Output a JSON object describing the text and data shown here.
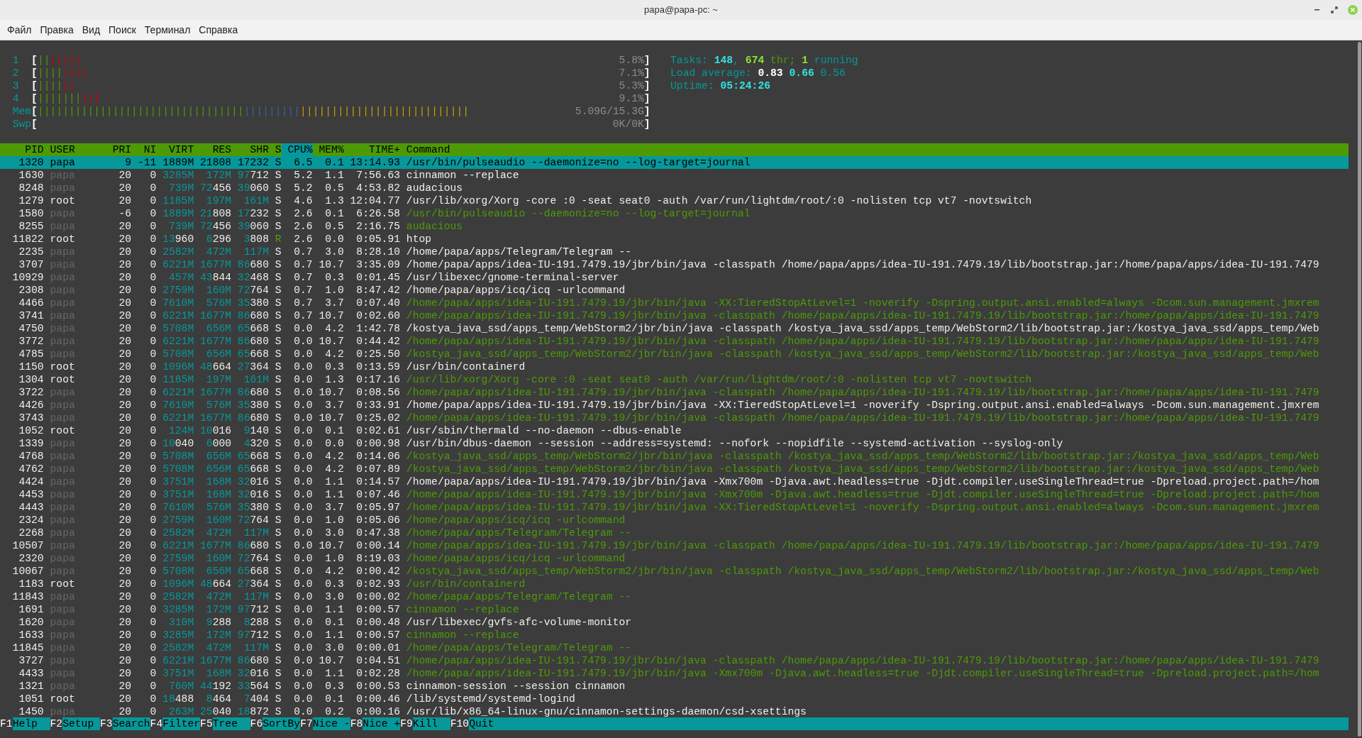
{
  "window": {
    "title": "papa@papa-pc: ~"
  },
  "menu": [
    "Файл",
    "Правка",
    "Вид",
    "Поиск",
    "Терминал",
    "Справка"
  ],
  "meters": [
    {
      "label": "1",
      "open": "[",
      "segments": [
        {
          "text": "||",
          "color": "#4e9a06"
        },
        {
          "text": "|||||",
          "color": "#cc0000"
        }
      ],
      "reading": "5.8%",
      "close": "]"
    },
    {
      "label": "2",
      "open": "[",
      "segments": [
        {
          "text": "||||",
          "color": "#4e9a06"
        },
        {
          "text": "||||",
          "color": "#cc0000"
        }
      ],
      "reading": "7.1%",
      "close": "]"
    },
    {
      "label": "3",
      "open": "[",
      "segments": [
        {
          "text": "||||",
          "color": "#4e9a06"
        },
        {
          "text": "||",
          "color": "#cc0000"
        }
      ],
      "reading": "5.3%",
      "close": "]"
    },
    {
      "label": "4",
      "open": "[",
      "segments": [
        {
          "text": "|||||||",
          "color": "#4e9a06"
        },
        {
          "text": "|||",
          "color": "#cc0000"
        }
      ],
      "reading": "9.1%",
      "close": "]"
    },
    {
      "label": "Mem",
      "open": "[",
      "segments": [
        {
          "text": "|||||||||||||||||||||||||||||||||",
          "color": "#4e9a06"
        },
        {
          "text": "|||||||||",
          "color": "#3465a4"
        },
        {
          "text": "|||||||||||||||||||||||||||",
          "color": "#c4a000"
        }
      ],
      "reading": "5.09G/15.3G",
      "close": "]"
    },
    {
      "label": "Swp",
      "open": "[",
      "reading": "0K/0K",
      "close": "]"
    }
  ],
  "tasks": {
    "label": "Tasks:",
    "total": "148",
    "sep": ",",
    "threads": "674",
    "threads_label": "thr;",
    "running": "1",
    "running_label": "running"
  },
  "load": {
    "label": "Load average:",
    "values": [
      "0.83",
      "0.66",
      "0.56"
    ]
  },
  "uptime": {
    "label": "Uptime:",
    "value": "05:24:26"
  },
  "columns": [
    {
      "label": "PID",
      "sorted": false
    },
    {
      "label": "USER",
      "sorted": false
    },
    {
      "label": "PRI",
      "sorted": false
    },
    {
      "label": "NI",
      "sorted": false
    },
    {
      "label": "VIRT",
      "sorted": false
    },
    {
      "label": "RES",
      "sorted": false
    },
    {
      "label": "SHR",
      "sorted": false
    },
    {
      "label": "S",
      "sorted": false
    },
    {
      "label": "CPU%",
      "sorted": true
    },
    {
      "label": "MEM%",
      "sorted": false
    },
    {
      "label": "TIME+",
      "sorted": false
    },
    {
      "label": "Command",
      "sorted": false
    }
  ],
  "rows": [
    {
      "pid": "1320",
      "user": "papa",
      "user_dim": false,
      "pri": "9",
      "ni": "-11",
      "virt": "1889M",
      "res": "21808",
      "shr": "17232",
      "s": "S",
      "running": false,
      "cpu": "6.5",
      "mem": "0.1",
      "time": "13:14.93",
      "command": "/usr/bin/pulseaudio --daemonize=no --log-target=journal",
      "thread": false,
      "selected": true
    },
    {
      "pid": "1630",
      "user": "papa",
      "user_dim": true,
      "pri": "20",
      "ni": "0",
      "virt": "3285M",
      "res": "172M",
      "shr": "97712",
      "s": "S",
      "running": false,
      "cpu": "5.2",
      "mem": "1.1",
      "time": "7:56.63",
      "command": "cinnamon --replace",
      "thread": false,
      "selected": false
    },
    {
      "pid": "8248",
      "user": "papa",
      "user_dim": true,
      "pri": "20",
      "ni": "0",
      "virt": "739M",
      "res": "72456",
      "shr": "39060",
      "s": "S",
      "running": false,
      "cpu": "5.2",
      "mem": "0.5",
      "time": "4:53.82",
      "command": "audacious",
      "thread": false,
      "selected": false
    },
    {
      "pid": "1279",
      "user": "root",
      "user_dim": false,
      "pri": "20",
      "ni": "0",
      "virt": "1185M",
      "res": "197M",
      "shr": "161M",
      "s": "S",
      "running": false,
      "cpu": "4.6",
      "mem": "1.3",
      "time": "12:04.77",
      "command": "/usr/lib/xorg/Xorg -core :0 -seat seat0 -auth /var/run/lightdm/root/:0 -nolisten tcp vt7 -novtswitch",
      "thread": false,
      "selected": false
    },
    {
      "pid": "1580",
      "user": "papa",
      "user_dim": true,
      "pri": "-6",
      "ni": "0",
      "virt": "1889M",
      "res": "21808",
      "shr": "17232",
      "s": "S",
      "running": false,
      "cpu": "2.6",
      "mem": "0.1",
      "time": "6:26.58",
      "command": "/usr/bin/pulseaudio --daemonize=no --log-target=journal",
      "thread": true,
      "selected": false
    },
    {
      "pid": "8255",
      "user": "papa",
      "user_dim": true,
      "pri": "20",
      "ni": "0",
      "virt": "739M",
      "res": "72456",
      "shr": "39060",
      "s": "S",
      "running": false,
      "cpu": "2.6",
      "mem": "0.5",
      "time": "2:16.75",
      "command": "audacious",
      "thread": true,
      "selected": false
    },
    {
      "pid": "11822",
      "user": "root",
      "user_dim": false,
      "pri": "20",
      "ni": "0",
      "virt": "13960",
      "res": "6296",
      "shr": "3808",
      "s": "R",
      "running": true,
      "cpu": "2.6",
      "mem": "0.0",
      "time": "0:05.91",
      "command": "htop",
      "thread": false,
      "selected": false
    },
    {
      "pid": "2235",
      "user": "papa",
      "user_dim": true,
      "pri": "20",
      "ni": "0",
      "virt": "2582M",
      "res": "472M",
      "shr": "117M",
      "s": "S",
      "running": false,
      "cpu": "0.7",
      "mem": "3.0",
      "time": "8:28.10",
      "command": "/home/papa/apps/Telegram/Telegram --",
      "thread": false,
      "selected": false
    },
    {
      "pid": "3707",
      "user": "papa",
      "user_dim": true,
      "pri": "20",
      "ni": "0",
      "virt": "6221M",
      "res": "1677M",
      "shr": "86680",
      "s": "S",
      "running": false,
      "cpu": "0.7",
      "mem": "10.7",
      "time": "3:35.09",
      "command": "/home/papa/apps/idea-IU-191.7479.19/jbr/bin/java -classpath /home/papa/apps/idea-IU-191.7479.19/lib/bootstrap.jar:/home/papa/apps/idea-IU-191.7479",
      "thread": false,
      "selected": false
    },
    {
      "pid": "10929",
      "user": "papa",
      "user_dim": true,
      "pri": "20",
      "ni": "0",
      "virt": "457M",
      "res": "43844",
      "shr": "32468",
      "s": "S",
      "running": false,
      "cpu": "0.7",
      "mem": "0.3",
      "time": "0:01.45",
      "command": "/usr/libexec/gnome-terminal-server",
      "thread": false,
      "selected": false
    },
    {
      "pid": "2308",
      "user": "papa",
      "user_dim": true,
      "pri": "20",
      "ni": "0",
      "virt": "2759M",
      "res": "160M",
      "shr": "72764",
      "s": "S",
      "running": false,
      "cpu": "0.7",
      "mem": "1.0",
      "time": "8:47.42",
      "command": "/home/papa/apps/icq/icq -urlcommand",
      "thread": false,
      "selected": false
    },
    {
      "pid": "4466",
      "user": "papa",
      "user_dim": true,
      "pri": "20",
      "ni": "0",
      "virt": "7610M",
      "res": "576M",
      "shr": "35380",
      "s": "S",
      "running": false,
      "cpu": "0.7",
      "mem": "3.7",
      "time": "0:07.40",
      "command": "/home/papa/apps/idea-IU-191.7479.19/jbr/bin/java -XX:TieredStopAtLevel=1 -noverify -Dspring.output.ansi.enabled=always -Dcom.sun.management.jmxrem",
      "thread": true,
      "selected": false
    },
    {
      "pid": "3741",
      "user": "papa",
      "user_dim": true,
      "pri": "20",
      "ni": "0",
      "virt": "6221M",
      "res": "1677M",
      "shr": "86680",
      "s": "S",
      "running": false,
      "cpu": "0.7",
      "mem": "10.7",
      "time": "0:02.60",
      "command": "/home/papa/apps/idea-IU-191.7479.19/jbr/bin/java -classpath /home/papa/apps/idea-IU-191.7479.19/lib/bootstrap.jar:/home/papa/apps/idea-IU-191.7479",
      "thread": true,
      "selected": false
    },
    {
      "pid": "4750",
      "user": "papa",
      "user_dim": true,
      "pri": "20",
      "ni": "0",
      "virt": "5708M",
      "res": "656M",
      "shr": "65668",
      "s": "S",
      "running": false,
      "cpu": "0.0",
      "mem": "4.2",
      "time": "1:42.78",
      "command": "/kostya_java_ssd/apps_temp/WebStorm2/jbr/bin/java -classpath /kostya_java_ssd/apps_temp/WebStorm2/lib/bootstrap.jar:/kostya_java_ssd/apps_temp/Web",
      "thread": false,
      "selected": false
    },
    {
      "pid": "3772",
      "user": "papa",
      "user_dim": true,
      "pri": "20",
      "ni": "0",
      "virt": "6221M",
      "res": "1677M",
      "shr": "86680",
      "s": "S",
      "running": false,
      "cpu": "0.0",
      "mem": "10.7",
      "time": "0:44.42",
      "command": "/home/papa/apps/idea-IU-191.7479.19/jbr/bin/java -classpath /home/papa/apps/idea-IU-191.7479.19/lib/bootstrap.jar:/home/papa/apps/idea-IU-191.7479",
      "thread": true,
      "selected": false
    },
    {
      "pid": "4785",
      "user": "papa",
      "user_dim": true,
      "pri": "20",
      "ni": "0",
      "virt": "5708M",
      "res": "656M",
      "shr": "65668",
      "s": "S",
      "running": false,
      "cpu": "0.0",
      "mem": "4.2",
      "time": "0:25.50",
      "command": "/kostya_java_ssd/apps_temp/WebStorm2/jbr/bin/java -classpath /kostya_java_ssd/apps_temp/WebStorm2/lib/bootstrap.jar:/kostya_java_ssd/apps_temp/Web",
      "thread": true,
      "selected": false
    },
    {
      "pid": "1150",
      "user": "root",
      "user_dim": false,
      "pri": "20",
      "ni": "0",
      "virt": "1096M",
      "res": "48664",
      "shr": "27364",
      "s": "S",
      "running": false,
      "cpu": "0.0",
      "mem": "0.3",
      "time": "0:13.59",
      "command": "/usr/bin/containerd",
      "thread": false,
      "selected": false
    },
    {
      "pid": "1304",
      "user": "root",
      "user_dim": false,
      "pri": "20",
      "ni": "0",
      "virt": "1185M",
      "res": "197M",
      "shr": "161M",
      "s": "S",
      "running": false,
      "cpu": "0.0",
      "mem": "1.3",
      "time": "0:17.16",
      "command": "/usr/lib/xorg/Xorg -core :0 -seat seat0 -auth /var/run/lightdm/root/:0 -nolisten tcp vt7 -novtswitch",
      "thread": true,
      "selected": false
    },
    {
      "pid": "3722",
      "user": "papa",
      "user_dim": true,
      "pri": "20",
      "ni": "0",
      "virt": "6221M",
      "res": "1677M",
      "shr": "86680",
      "s": "S",
      "running": false,
      "cpu": "0.0",
      "mem": "10.7",
      "time": "0:08.56",
      "command": "/home/papa/apps/idea-IU-191.7479.19/jbr/bin/java -classpath /home/papa/apps/idea-IU-191.7479.19/lib/bootstrap.jar:/home/papa/apps/idea-IU-191.7479",
      "thread": true,
      "selected": false
    },
    {
      "pid": "4426",
      "user": "papa",
      "user_dim": true,
      "pri": "20",
      "ni": "0",
      "virt": "7610M",
      "res": "576M",
      "shr": "35380",
      "s": "S",
      "running": false,
      "cpu": "0.0",
      "mem": "3.7",
      "time": "0:33.91",
      "command": "/home/papa/apps/idea-IU-191.7479.19/jbr/bin/java -XX:TieredStopAtLevel=1 -noverify -Dspring.output.ansi.enabled=always -Dcom.sun.management.jmxrem",
      "thread": false,
      "selected": false
    },
    {
      "pid": "3743",
      "user": "papa",
      "user_dim": true,
      "pri": "20",
      "ni": "0",
      "virt": "6221M",
      "res": "1677M",
      "shr": "86680",
      "s": "S",
      "running": false,
      "cpu": "0.0",
      "mem": "10.7",
      "time": "0:25.02",
      "command": "/home/papa/apps/idea-IU-191.7479.19/jbr/bin/java -classpath /home/papa/apps/idea-IU-191.7479.19/lib/bootstrap.jar:/home/papa/apps/idea-IU-191.7479",
      "thread": true,
      "selected": false
    },
    {
      "pid": "1052",
      "user": "root",
      "user_dim": false,
      "pri": "20",
      "ni": "0",
      "virt": "124M",
      "res": "10016",
      "shr": "9140",
      "s": "S",
      "running": false,
      "cpu": "0.0",
      "mem": "0.1",
      "time": "0:02.61",
      "command": "/usr/sbin/thermald --no-daemon --dbus-enable",
      "thread": false,
      "selected": false
    },
    {
      "pid": "1339",
      "user": "papa",
      "user_dim": true,
      "pri": "20",
      "ni": "0",
      "virt": "10040",
      "res": "6000",
      "shr": "4320",
      "s": "S",
      "running": false,
      "cpu": "0.0",
      "mem": "0.0",
      "time": "0:00.98",
      "command": "/usr/bin/dbus-daemon --session --address=systemd: --nofork --nopidfile --systemd-activation --syslog-only",
      "thread": false,
      "selected": false
    },
    {
      "pid": "4768",
      "user": "papa",
      "user_dim": true,
      "pri": "20",
      "ni": "0",
      "virt": "5708M",
      "res": "656M",
      "shr": "65668",
      "s": "S",
      "running": false,
      "cpu": "0.0",
      "mem": "4.2",
      "time": "0:14.06",
      "command": "/kostya_java_ssd/apps_temp/WebStorm2/jbr/bin/java -classpath /kostya_java_ssd/apps_temp/WebStorm2/lib/bootstrap.jar:/kostya_java_ssd/apps_temp/Web",
      "thread": true,
      "selected": false
    },
    {
      "pid": "4762",
      "user": "papa",
      "user_dim": true,
      "pri": "20",
      "ni": "0",
      "virt": "5708M",
      "res": "656M",
      "shr": "65668",
      "s": "S",
      "running": false,
      "cpu": "0.0",
      "mem": "4.2",
      "time": "0:07.89",
      "command": "/kostya_java_ssd/apps_temp/WebStorm2/jbr/bin/java -classpath /kostya_java_ssd/apps_temp/WebStorm2/lib/bootstrap.jar:/kostya_java_ssd/apps_temp/Web",
      "thread": true,
      "selected": false
    },
    {
      "pid": "4424",
      "user": "papa",
      "user_dim": true,
      "pri": "20",
      "ni": "0",
      "virt": "3751M",
      "res": "168M",
      "shr": "32016",
      "s": "S",
      "running": false,
      "cpu": "0.0",
      "mem": "1.1",
      "time": "0:14.57",
      "command": "/home/papa/apps/idea-IU-191.7479.19/jbr/bin/java -Xmx700m -Djava.awt.headless=true -Djdt.compiler.useSingleThread=true -Dpreload.project.path=/hom",
      "thread": false,
      "selected": false
    },
    {
      "pid": "4453",
      "user": "papa",
      "user_dim": true,
      "pri": "20",
      "ni": "0",
      "virt": "3751M",
      "res": "168M",
      "shr": "32016",
      "s": "S",
      "running": false,
      "cpu": "0.0",
      "mem": "1.1",
      "time": "0:07.46",
      "command": "/home/papa/apps/idea-IU-191.7479.19/jbr/bin/java -Xmx700m -Djava.awt.headless=true -Djdt.compiler.useSingleThread=true -Dpreload.project.path=/hom",
      "thread": true,
      "selected": false
    },
    {
      "pid": "4443",
      "user": "papa",
      "user_dim": true,
      "pri": "20",
      "ni": "0",
      "virt": "7610M",
      "res": "576M",
      "shr": "35380",
      "s": "S",
      "running": false,
      "cpu": "0.0",
      "mem": "3.7",
      "time": "0:05.97",
      "command": "/home/papa/apps/idea-IU-191.7479.19/jbr/bin/java -XX:TieredStopAtLevel=1 -noverify -Dspring.output.ansi.enabled=always -Dcom.sun.management.jmxrem",
      "thread": true,
      "selected": false
    },
    {
      "pid": "2324",
      "user": "papa",
      "user_dim": true,
      "pri": "20",
      "ni": "0",
      "virt": "2759M",
      "res": "160M",
      "shr": "72764",
      "s": "S",
      "running": false,
      "cpu": "0.0",
      "mem": "1.0",
      "time": "0:05.06",
      "command": "/home/papa/apps/icq/icq -urlcommand",
      "thread": true,
      "selected": false
    },
    {
      "pid": "2268",
      "user": "papa",
      "user_dim": true,
      "pri": "20",
      "ni": "0",
      "virt": "2582M",
      "res": "472M",
      "shr": "117M",
      "s": "S",
      "running": false,
      "cpu": "0.0",
      "mem": "3.0",
      "time": "0:47.38",
      "command": "/home/papa/apps/Telegram/Telegram --",
      "thread": true,
      "selected": false
    },
    {
      "pid": "10507",
      "user": "papa",
      "user_dim": true,
      "pri": "20",
      "ni": "0",
      "virt": "6221M",
      "res": "1677M",
      "shr": "86680",
      "s": "S",
      "running": false,
      "cpu": "0.0",
      "mem": "10.7",
      "time": "0:00.14",
      "command": "/home/papa/apps/idea-IU-191.7479.19/jbr/bin/java -classpath /home/papa/apps/idea-IU-191.7479.19/lib/bootstrap.jar:/home/papa/apps/idea-IU-191.7479",
      "thread": true,
      "selected": false
    },
    {
      "pid": "2320",
      "user": "papa",
      "user_dim": true,
      "pri": "20",
      "ni": "0",
      "virt": "2759M",
      "res": "160M",
      "shr": "72764",
      "s": "S",
      "running": false,
      "cpu": "0.0",
      "mem": "1.0",
      "time": "8:19.03",
      "command": "/home/papa/apps/icq/icq -urlcommand",
      "thread": true,
      "selected": false
    },
    {
      "pid": "10067",
      "user": "papa",
      "user_dim": true,
      "pri": "20",
      "ni": "0",
      "virt": "5708M",
      "res": "656M",
      "shr": "65668",
      "s": "S",
      "running": false,
      "cpu": "0.0",
      "mem": "4.2",
      "time": "0:00.42",
      "command": "/kostya_java_ssd/apps_temp/WebStorm2/jbr/bin/java -classpath /kostya_java_ssd/apps_temp/WebStorm2/lib/bootstrap.jar:/kostya_java_ssd/apps_temp/Web",
      "thread": true,
      "selected": false
    },
    {
      "pid": "1183",
      "user": "root",
      "user_dim": false,
      "pri": "20",
      "ni": "0",
      "virt": "1096M",
      "res": "48664",
      "shr": "27364",
      "s": "S",
      "running": false,
      "cpu": "0.0",
      "mem": "0.3",
      "time": "0:02.93",
      "command": "/usr/bin/containerd",
      "thread": true,
      "selected": false
    },
    {
      "pid": "11843",
      "user": "papa",
      "user_dim": true,
      "pri": "20",
      "ni": "0",
      "virt": "2582M",
      "res": "472M",
      "shr": "117M",
      "s": "S",
      "running": false,
      "cpu": "0.0",
      "mem": "3.0",
      "time": "0:00.02",
      "command": "/home/papa/apps/Telegram/Telegram --",
      "thread": true,
      "selected": false
    },
    {
      "pid": "1691",
      "user": "papa",
      "user_dim": true,
      "pri": "20",
      "ni": "0",
      "virt": "3285M",
      "res": "172M",
      "shr": "97712",
      "s": "S",
      "running": false,
      "cpu": "0.0",
      "mem": "1.1",
      "time": "0:00.57",
      "command": "cinnamon --replace",
      "thread": true,
      "selected": false
    },
    {
      "pid": "1620",
      "user": "papa",
      "user_dim": true,
      "pri": "20",
      "ni": "0",
      "virt": "310M",
      "res": "9288",
      "shr": "8288",
      "s": "S",
      "running": false,
      "cpu": "0.0",
      "mem": "0.1",
      "time": "0:00.48",
      "command": "/usr/libexec/gvfs-afc-volume-monitor",
      "thread": false,
      "selected": false
    },
    {
      "pid": "1633",
      "user": "papa",
      "user_dim": true,
      "pri": "20",
      "ni": "0",
      "virt": "3285M",
      "res": "172M",
      "shr": "97712",
      "s": "S",
      "running": false,
      "cpu": "0.0",
      "mem": "1.1",
      "time": "0:00.57",
      "command": "cinnamon --replace",
      "thread": true,
      "selected": false
    },
    {
      "pid": "11845",
      "user": "papa",
      "user_dim": true,
      "pri": "20",
      "ni": "0",
      "virt": "2582M",
      "res": "472M",
      "shr": "117M",
      "s": "S",
      "running": false,
      "cpu": "0.0",
      "mem": "3.0",
      "time": "0:00.01",
      "command": "/home/papa/apps/Telegram/Telegram --",
      "thread": true,
      "selected": false
    },
    {
      "pid": "3727",
      "user": "papa",
      "user_dim": true,
      "pri": "20",
      "ni": "0",
      "virt": "6221M",
      "res": "1677M",
      "shr": "86680",
      "s": "S",
      "running": false,
      "cpu": "0.0",
      "mem": "10.7",
      "time": "0:04.51",
      "command": "/home/papa/apps/idea-IU-191.7479.19/jbr/bin/java -classpath /home/papa/apps/idea-IU-191.7479.19/lib/bootstrap.jar:/home/papa/apps/idea-IU-191.7479",
      "thread": true,
      "selected": false
    },
    {
      "pid": "4433",
      "user": "papa",
      "user_dim": true,
      "pri": "20",
      "ni": "0",
      "virt": "3751M",
      "res": "168M",
      "shr": "32016",
      "s": "S",
      "running": false,
      "cpu": "0.0",
      "mem": "1.1",
      "time": "0:02.28",
      "command": "/home/papa/apps/idea-IU-191.7479.19/jbr/bin/java -Xmx700m -Djava.awt.headless=true -Djdt.compiler.useSingleThread=true -Dpreload.project.path=/hom",
      "thread": true,
      "selected": false
    },
    {
      "pid": "1321",
      "user": "papa",
      "user_dim": true,
      "pri": "20",
      "ni": "0",
      "virt": "760M",
      "res": "44192",
      "shr": "33564",
      "s": "S",
      "running": false,
      "cpu": "0.0",
      "mem": "0.3",
      "time": "0:00.53",
      "command": "cinnamon-session --session cinnamon",
      "thread": false,
      "selected": false
    },
    {
      "pid": "1051",
      "user": "root",
      "user_dim": false,
      "pri": "20",
      "ni": "0",
      "virt": "18488",
      "res": "8464",
      "shr": "7404",
      "s": "S",
      "running": false,
      "cpu": "0.0",
      "mem": "0.1",
      "time": "0:00.46",
      "command": "/lib/systemd/systemd-logind",
      "thread": false,
      "selected": false
    },
    {
      "pid": "1450",
      "user": "papa",
      "user_dim": true,
      "pri": "20",
      "ni": "0",
      "virt": "263M",
      "res": "25040",
      "shr": "18872",
      "s": "S",
      "running": false,
      "cpu": "0.0",
      "mem": "0.2",
      "time": "0:00.16",
      "command": "/usr/lib/x86_64-linux-gnu/cinnamon-settings-daemon/csd-xsettings",
      "thread": false,
      "selected": false
    }
  ],
  "function_keys": [
    {
      "key": "F1",
      "label": "Help"
    },
    {
      "key": "F2",
      "label": "Setup"
    },
    {
      "key": "F3",
      "label": "Search"
    },
    {
      "key": "F4",
      "label": "Filter"
    },
    {
      "key": "F5",
      "label": "Tree"
    },
    {
      "key": "F6",
      "label": "SortBy"
    },
    {
      "key": "F7",
      "label": "Nice -"
    },
    {
      "key": "F8",
      "label": "Nice +"
    },
    {
      "key": "F9",
      "label": "Kill"
    },
    {
      "key": "F10",
      "label": "Quit"
    }
  ]
}
